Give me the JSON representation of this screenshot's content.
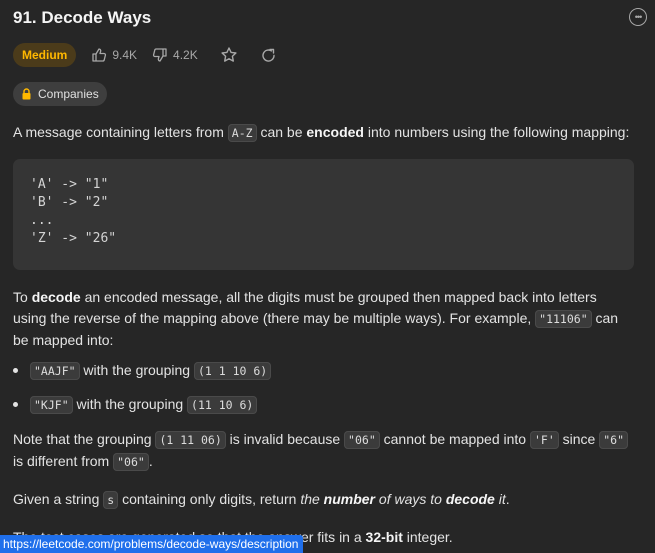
{
  "problem": {
    "title": "91. Decode Ways",
    "difficulty": "Medium",
    "likes": "9.4K",
    "dislikes": "4.2K",
    "companies_label": "Companies"
  },
  "description": {
    "p1_a": "A message containing letters from ",
    "p1_code": "A-Z",
    "p1_b": " can be ",
    "p1_bold": "encoded",
    "p1_c": " into numbers using the following mapping:",
    "mapping_block": "'A' -> \"1\"\n'B' -> \"2\"\n...\n'Z' -> \"26\"",
    "p2_a": "To ",
    "p2_bold": "decode",
    "p2_b": " an encoded message, all the digits must be grouped then mapped back into letters using the reverse of the mapping above (there may be multiple ways). For example, ",
    "p2_code": "\"11106\"",
    "p2_c": " can be mapped into:",
    "bullets": [
      {
        "code": "\"AAJF\"",
        "text": " with the grouping ",
        "group": "(1 1 10 6)"
      },
      {
        "code": "\"KJF\"",
        "text": " with the grouping ",
        "group": "(11 10 6)"
      }
    ],
    "p3_a": "Note that the grouping ",
    "p3_code1": "(1 11 06)",
    "p3_b": " is invalid because ",
    "p3_code2": "\"06\"",
    "p3_c": " cannot be mapped into ",
    "p3_code3": "'F'",
    "p3_d": " since ",
    "p3_code4": "\"6\"",
    "p3_e": " is different from ",
    "p3_code5": "\"06\"",
    "p3_f": ".",
    "p4_a": "Given a string ",
    "p4_code": "s",
    "p4_b": " containing only digits, return ",
    "p4_i1": "the ",
    "p4_bi1": "number",
    "p4_i2": " of ways to ",
    "p4_bi2": "decode",
    "p4_i3": " it",
    "p4_end": ".",
    "p5_a": "The test cases are generated so that the answer fits in a ",
    "p5_bold": "32-bit",
    "p5_b": " integer."
  },
  "status_bar": {
    "url": "https://leetcode.com/problems/decode-ways/description"
  },
  "colors": {
    "background": "#262626",
    "difficulty_medium": "#ffb800",
    "status_link_bg": "#1f6feb"
  },
  "icons": [
    "more-icon",
    "thumbs-up-icon",
    "thumbs-down-icon",
    "star-icon",
    "share-icon",
    "lock-icon"
  ]
}
